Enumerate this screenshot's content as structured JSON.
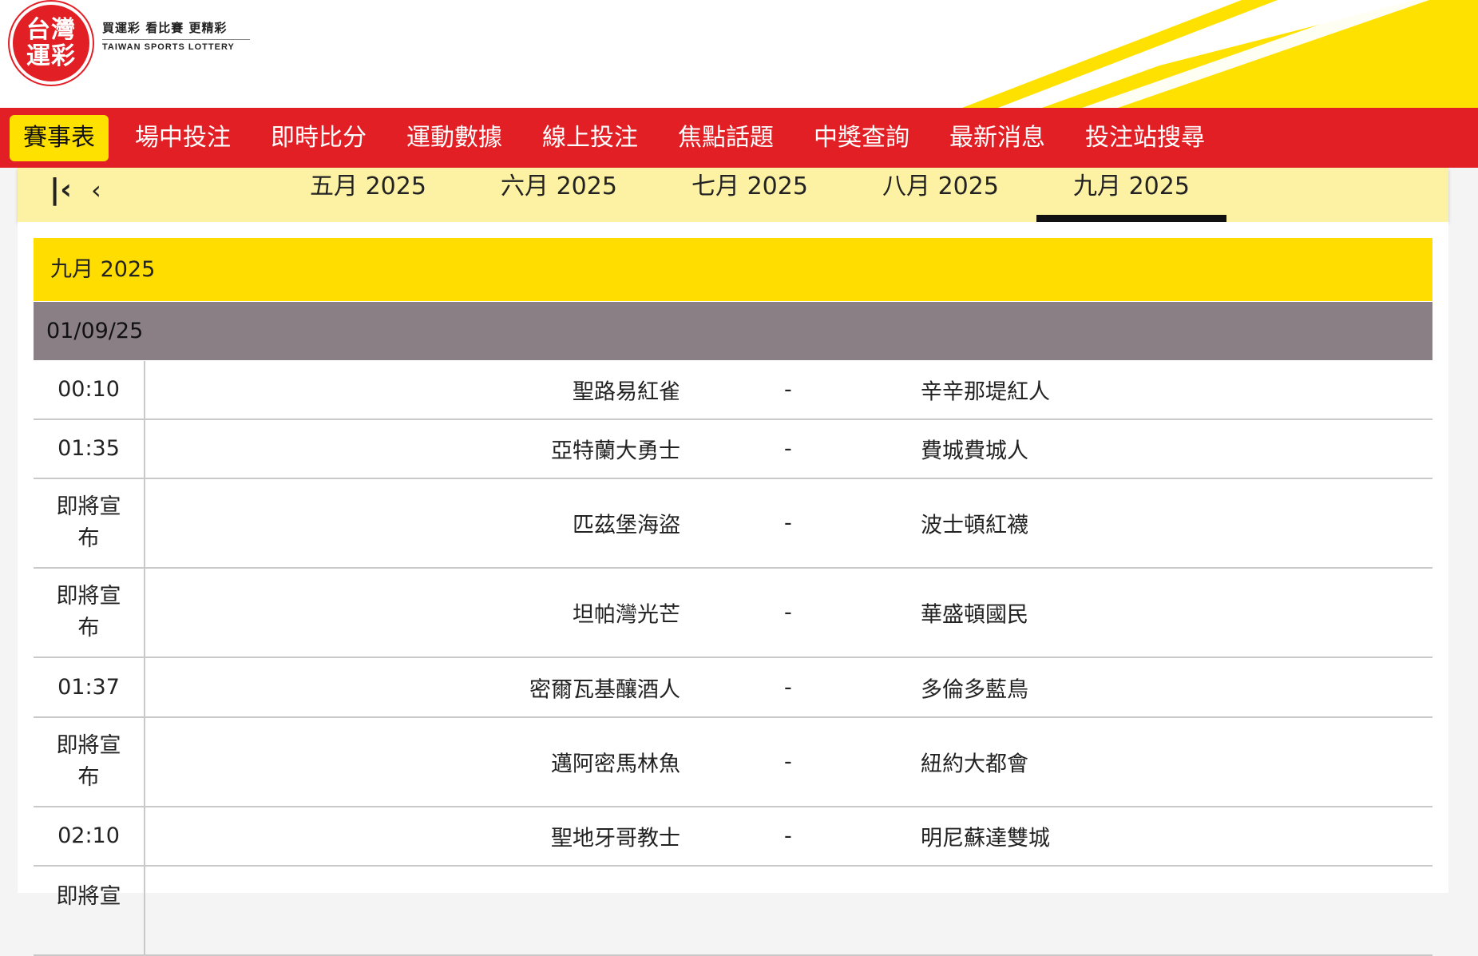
{
  "brand": {
    "logo_text": "台灣運彩",
    "slogan": "買運彩  看比賽  更精彩",
    "name_en": "TAIWAN SPORTS LOTTERY",
    "colors": {
      "red": "#e11f25",
      "yellow": "#ffe100"
    }
  },
  "nav": {
    "items": [
      {
        "label": "賽事表",
        "active": true
      },
      {
        "label": "場中投注"
      },
      {
        "label": "即時比分"
      },
      {
        "label": "運動數據"
      },
      {
        "label": "線上投注"
      },
      {
        "label": "焦點話題"
      },
      {
        "label": "中獎查詢"
      },
      {
        "label": "最新消息"
      },
      {
        "label": "投注站搜尋"
      }
    ]
  },
  "month_strip": {
    "first_icon": "first-page-icon",
    "prev_icon": "chevron-left-icon",
    "months": [
      {
        "label": "五月 2025"
      },
      {
        "label": "六月 2025"
      },
      {
        "label": "七月 2025"
      },
      {
        "label": "八月 2025"
      },
      {
        "label": "九月 2025",
        "active": true
      }
    ]
  },
  "schedule": {
    "month_title": "九月 2025",
    "date": "01/09/25",
    "separator": "-",
    "games": [
      {
        "time": "00:10",
        "home": "聖路易紅雀",
        "away": "辛辛那堤紅人"
      },
      {
        "time": "01:35",
        "home": "亞特蘭大勇士",
        "away": "費城費城人"
      },
      {
        "time": "即將宣布",
        "home": "匹茲堡海盜",
        "away": "波士頓紅襪"
      },
      {
        "time": "即將宣布",
        "home": "坦帕灣光芒",
        "away": "華盛頓國民"
      },
      {
        "time": "01:37",
        "home": "密爾瓦基釀酒人",
        "away": "多倫多藍鳥"
      },
      {
        "time": "即將宣布",
        "home": "邁阿密馬林魚",
        "away": "紐約大都會"
      },
      {
        "time": "02:10",
        "home": "聖地牙哥教士",
        "away": "明尼蘇達雙城"
      },
      {
        "time": "即將宣",
        "home": "",
        "away": ""
      }
    ]
  }
}
